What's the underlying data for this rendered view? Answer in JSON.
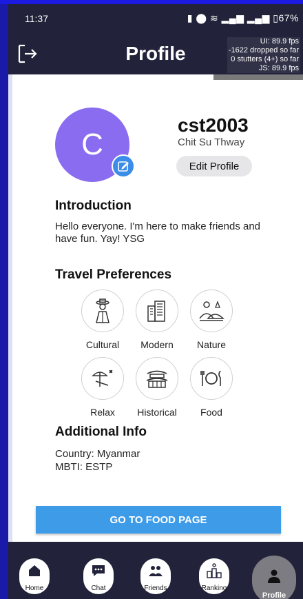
{
  "status": {
    "time": "11:37",
    "battery": "67%"
  },
  "header": {
    "title": "Profile"
  },
  "perf": {
    "ui": "UI: 89.9 fps",
    "dropped": "-1622 dropped so far",
    "stutters": "0 stutters (4+) so far",
    "js": "JS: 89.9 fps"
  },
  "profile": {
    "avatar_letter": "C",
    "username": "cst2003",
    "fullname": "Chit Su Thway",
    "edit_label": "Edit Profile"
  },
  "introduction": {
    "title": "Introduction",
    "text": "Hello everyone. I'm here to make friends and have fun. Yay! YSG"
  },
  "travel": {
    "title": "Travel Preferences",
    "items": [
      {
        "label": "Cultural",
        "icon": "cultural-person-icon"
      },
      {
        "label": "Modern",
        "icon": "modern-building-icon"
      },
      {
        "label": "Nature",
        "icon": "nature-landscape-icon"
      },
      {
        "label": "Relax",
        "icon": "relax-beach-icon"
      },
      {
        "label": "Historical",
        "icon": "historical-temple-icon"
      },
      {
        "label": "Food",
        "icon": "food-plate-icon"
      }
    ]
  },
  "additional": {
    "title": "Additional Info",
    "country": "Country: Myanmar",
    "mbti": "MBTI: ESTP"
  },
  "food_button": "GO TO FOOD PAGE",
  "nav": {
    "home": "Home",
    "chat": "Chat",
    "friends": "Friends",
    "ranking": "Ranking",
    "profile": "Profile"
  },
  "colors": {
    "header_bg": "#22223a",
    "avatar": "#8a6cf0",
    "accent_blue": "#3d9be8"
  }
}
